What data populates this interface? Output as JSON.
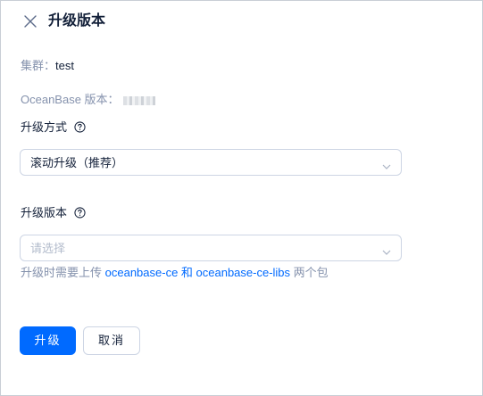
{
  "header": {
    "title": "升级版本"
  },
  "cluster": {
    "label": "集群：",
    "value": "test"
  },
  "oceanbase_version": {
    "label": "OceanBase 版本："
  },
  "upgrade_method": {
    "label": "升级方式",
    "selected": "滚动升级（推荐）"
  },
  "upgrade_version": {
    "label": "升级版本",
    "placeholder": "请选择"
  },
  "hint": {
    "prefix": "升级时需要上传 ",
    "pkg1": "oceanbase-ce",
    "and": " 和 ",
    "pkg2": "oceanbase-ce-libs",
    "suffix": " 两个包"
  },
  "actions": {
    "upgrade_label": "升级",
    "cancel_label": "取消"
  },
  "colors": {
    "primary": "#006aff",
    "text": "#132039",
    "muted": "#8592ad",
    "border": "#cdd5e4"
  }
}
